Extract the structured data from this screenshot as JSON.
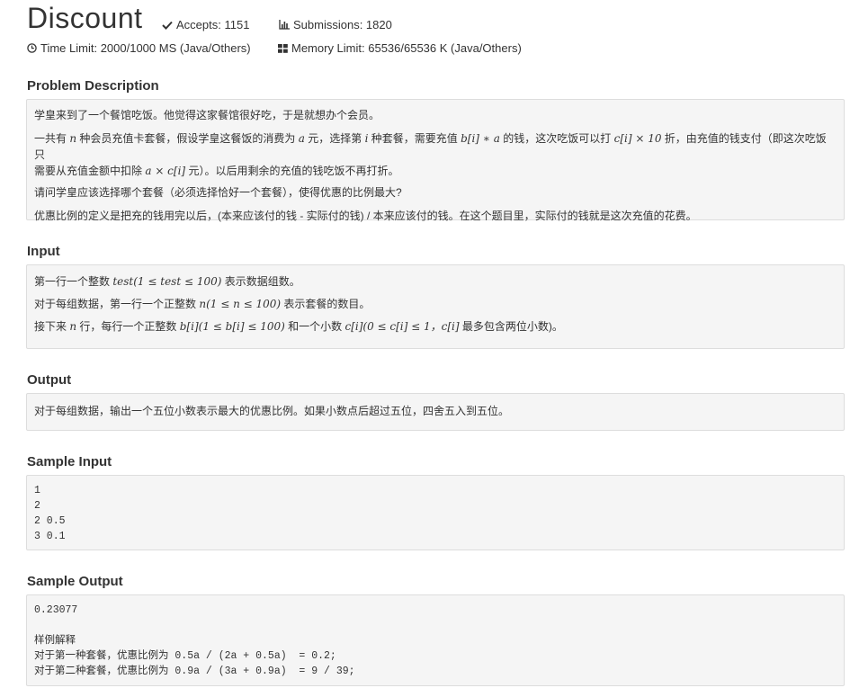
{
  "problem": {
    "title": "Discount",
    "accepts_label": "Accepts: 1151",
    "submissions_label": "Submissions: 1820",
    "time_limit_label": "Time Limit: 2000/1000 MS (Java/Others)",
    "memory_limit_label": "Memory Limit: 65536/65536 K (Java/Others)",
    "icons": [
      "check-icon",
      "bar-chart-icon",
      "clock-icon",
      "grid-icon"
    ]
  },
  "description": {
    "heading": "Problem Description",
    "p1": "学皇来到了一个餐馆吃饭。他觉得这家餐馆很好吃，于是就想办个会员。",
    "p2_a": "一共有 ",
    "p2_b": "n",
    "p2_c": " 种会员充值卡套餐，假设学皇这餐饭的消费为 ",
    "p2_d": "a",
    "p2_e": " 元，选择第 ",
    "p2_f": "i",
    "p2_g": " 种套餐，需要充值 ",
    "p2_h": "b[i] ∗ a",
    "p2_i": " 的钱，这次吃饭可以打 ",
    "p2_j": "c[i] × 10",
    "p2_k": " 折，由充值的钱支付（即这次吃饭只",
    "p2_l": "需要从充值金额中扣除 ",
    "p2_m": "a × c[i]",
    "p2_n": " 元）。以后用剩余的充值的钱吃饭不再打折。",
    "p3": "请问学皇应该选择哪个套餐（必须选择恰好一个套餐），使得优惠的比例最大?",
    "p4": "优惠比例的定义是把充的钱用完以后，(本来应该付的钱 - 实际付的钱) / 本来应该付的钱。在这个题目里，实际付的钱就是这次充值的花费。"
  },
  "input": {
    "heading": "Input",
    "l1_a": "第一行一个整数 ",
    "l1_b": "test(1 ≤ test ≤ 100)",
    "l1_c": " 表示数据组数。",
    "l2_a": "对于每组数据，第一行一个正整数 ",
    "l2_b": "n(1 ≤ n ≤ 100)",
    "l2_c": " 表示套餐的数目。",
    "l3_a": "接下来 ",
    "l3_b": "n",
    "l3_c": " 行，每行一个正整数 ",
    "l3_d": "b[i](1 ≤ b[i] ≤ 100)",
    "l3_e": " 和一个小数 ",
    "l3_f": "c[i](0 ≤ c[i] ≤ 1，c[i]",
    "l3_g": " 最多包含两位小数)。"
  },
  "output": {
    "heading": "Output",
    "text": "对于每组数据，输出一个五位小数表示最大的优惠比例。如果小数点后超过五位，四舍五入到五位。"
  },
  "sample_input": {
    "heading": "Sample Input",
    "lines": [
      "1",
      "2",
      "2 0.5",
      "3 0.1"
    ]
  },
  "sample_output": {
    "heading": "Sample Output",
    "lines": [
      "0.23077",
      "",
      "样例解释",
      "对于第一种套餐，优惠比例为 0.5a / (2a + 0.5a)  = 0.2;",
      "对于第二种套餐，优惠比例为 0.9a / (3a + 0.9a)  = 9 / 39;"
    ]
  }
}
